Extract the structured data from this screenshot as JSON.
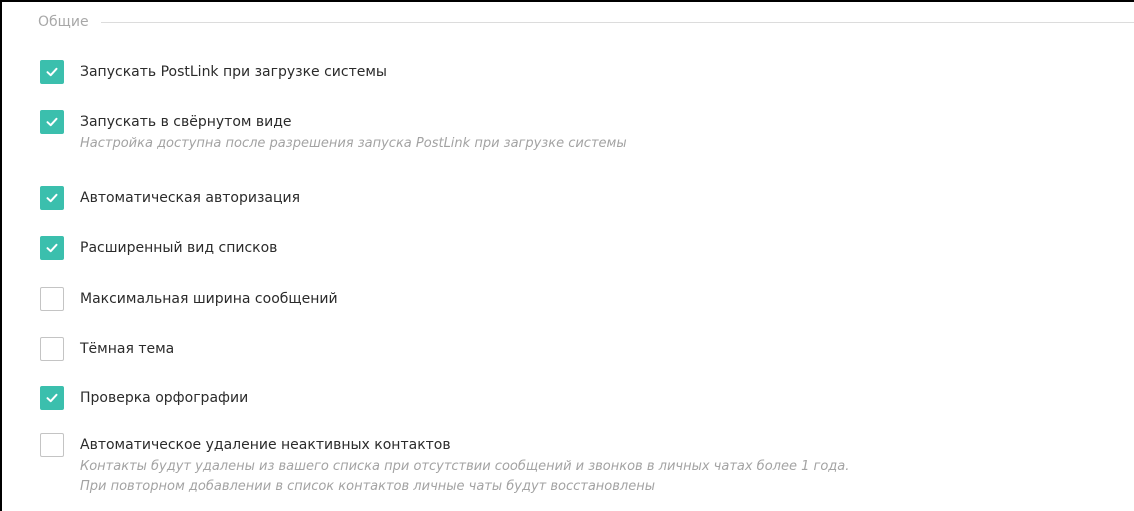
{
  "group": {
    "title": "Общие"
  },
  "options": [
    {
      "label": "Запускать PostLink при загрузке системы",
      "checked": true,
      "hints": []
    },
    {
      "label": "Запускать в свёрнутом виде",
      "checked": true,
      "hints": [
        "Настройка доступна после разрешения запуска PostLink при загрузке системы"
      ]
    },
    {
      "label": "Автоматическая авторизация",
      "checked": true,
      "hints": []
    },
    {
      "label": "Расширенный вид списков",
      "checked": true,
      "hints": []
    },
    {
      "label": "Максимальная ширина сообщений",
      "checked": false,
      "hints": []
    },
    {
      "label": "Тёмная тема",
      "checked": false,
      "hints": []
    },
    {
      "label": "Проверка орфографии",
      "checked": true,
      "hints": []
    },
    {
      "label": "Автоматическое удаление неактивных контактов",
      "checked": false,
      "hints": [
        "Контакты будут удалены из вашего списка при отсутствии сообщений и звонков в личных чатах более 1 года.",
        "При повторном добавлении в список контактов личные чаты будут восстановлены"
      ]
    }
  ],
  "colors": {
    "accent": "#3bbfad",
    "checkbox_border": "#c4c4c4",
    "label": "#2b2b2b",
    "hint": "#a3a3a3",
    "group_title": "#a8a8a8"
  },
  "icons": {
    "checked": "checkmark-icon"
  }
}
